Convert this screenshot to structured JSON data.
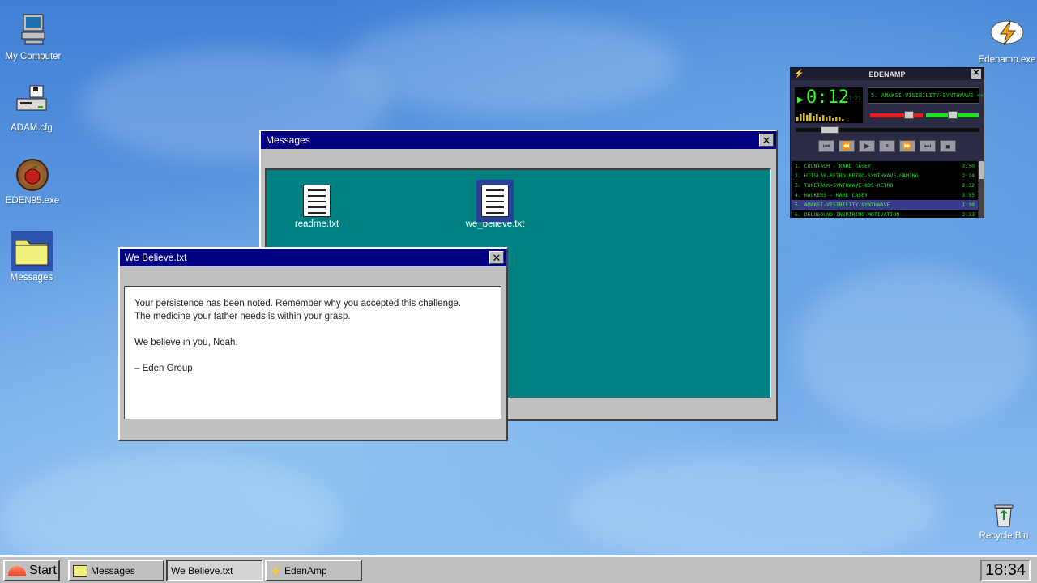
{
  "desktop": {
    "icons": [
      {
        "label": "My Computer"
      },
      {
        "label": "ADAM.cfg"
      },
      {
        "label": "EDEN95.exe"
      },
      {
        "label": "Messages"
      },
      {
        "label": "Edenamp.exe"
      },
      {
        "label": "Recycle Bin"
      }
    ]
  },
  "messages_window": {
    "title": "Messages",
    "close": "✕",
    "files": [
      {
        "label": "readme.txt"
      },
      {
        "label": "we_believe.txt"
      }
    ]
  },
  "believe_window": {
    "title": "We Believe.txt",
    "close": "✕",
    "lines": [
      "Your persistence has been noted. Remember why you accepted this challenge.",
      "The medicine your father needs is within your grasp.",
      "",
      "We believe in you, Noah.",
      "",
      "– Eden Group"
    ]
  },
  "edenamp": {
    "title": "EDENAMP",
    "close": "✕",
    "time": "0:12",
    "remaining": "-1:21",
    "marquee": "5. AMAKSI-VISIBILITY-SYNTHWAVE <<",
    "playlist": [
      {
        "title": "1. COUNTACH - KARL CASEY",
        "time": "3:50"
      },
      {
        "title": "2. HITSLAB-RETRO-RETRO-SYNTHWAVE-GAMING",
        "time": "2:24"
      },
      {
        "title": "3. TUNETANK-SYNTHWAVE-80S-RETRO",
        "time": "2:32"
      },
      {
        "title": "4. HACKERS - KARL CASEY",
        "time": "3:55"
      },
      {
        "title": "5. AMAKSI-VISIBILITY-SYNTHWAVE",
        "time": "1:30"
      },
      {
        "title": "6. DELOSOUND-INSPIRING-MOTIVATION",
        "time": "2:33"
      }
    ],
    "current_index": 4,
    "seek_fraction": 0.15,
    "volume_fraction": 0.8,
    "balance_fraction": 0.5
  },
  "taskbar": {
    "start": "Start",
    "items": [
      {
        "label": "Messages"
      },
      {
        "label": "We Believe.txt"
      },
      {
        "label": "EdenAmp"
      }
    ],
    "clock": "18:34"
  },
  "colors": {
    "titlebar": "#000080",
    "folder_content": "#008080",
    "amp_green": "#22dd22"
  }
}
